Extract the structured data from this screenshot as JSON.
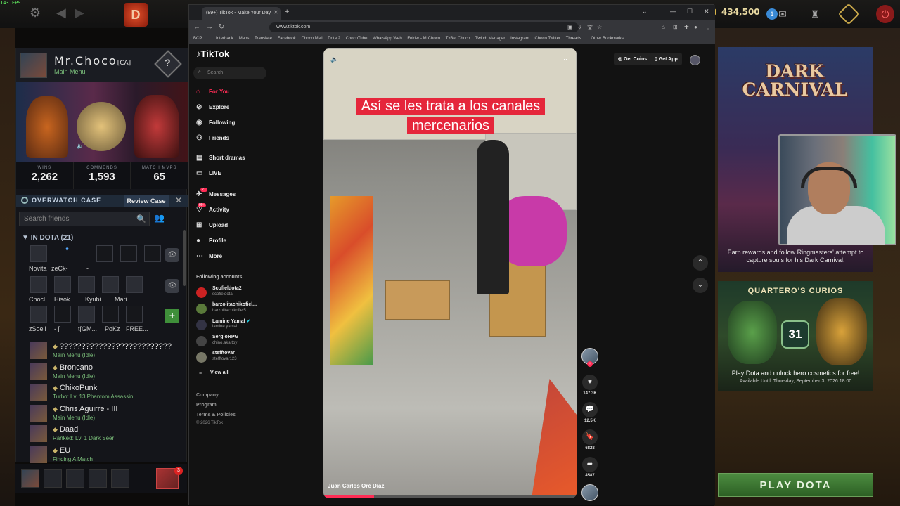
{
  "topbar": {
    "fps": "143 FPS",
    "gold": "434,500",
    "notif_count": "1"
  },
  "profile": {
    "name": "Mr.Choco",
    "tag": "[CA]",
    "status": "Main Menu",
    "stats": [
      {
        "label": "WINS",
        "value": "2,262"
      },
      {
        "label": "COMMENDS",
        "value": "1,593"
      },
      {
        "label": "MATCH MVPS",
        "value": "65"
      }
    ],
    "overwatch_label": "OVERWATCH CASE",
    "review_label": "Review Case",
    "search_placeholder": "Search friends",
    "in_dota_header": "IN DOTA (21)",
    "grid_names": [
      [
        "Novita",
        "zeCk-",
        "-"
      ],
      [
        "Chocl...",
        "Hisok...",
        "Kyubi...",
        "Mari..."
      ],
      [
        "zSoeli",
        "- [",
        "t[GM...",
        "PoKz",
        "FREE..."
      ]
    ],
    "friends": [
      {
        "name": "??????????????????????????",
        "status": "Main Menu (Idle)"
      },
      {
        "name": "Broncano",
        "status": "Main Menu (Idle)"
      },
      {
        "name": "ChikoPunk",
        "status": "Turbo: Lvl 13 Phantom Assassin"
      },
      {
        "name": "Chris Aguirre - III",
        "status": "Main Menu (Idle)"
      },
      {
        "name": "Daad",
        "status": "Ranked: Lvl 1 Dark Seer"
      },
      {
        "name": "EU",
        "status": "Finding A Match"
      }
    ],
    "party_badge": "3"
  },
  "browser": {
    "tab_title": "(89+) TikTok - Make Your Day",
    "url": "www.tiktok.com",
    "bookmarks": [
      "BCP",
      "Interbank",
      "Maps",
      "Translate",
      "Facebook",
      "Choco Mail",
      "Dota 2",
      "ChocoTube",
      "WhatsApp Web",
      "Folder - MrChoco",
      "TxBet Choco",
      "Twitch Manager",
      "Instagram",
      "Choco Twitter",
      "Threads",
      "Other Bookmarks"
    ]
  },
  "tiktok": {
    "logo": "TikTok",
    "search_placeholder": "Search",
    "nav": [
      {
        "label": "For You",
        "icon": "home-icon"
      },
      {
        "label": "Explore",
        "icon": "compass-icon"
      },
      {
        "label": "Following",
        "icon": "following-icon"
      },
      {
        "label": "Friends",
        "icon": "friends-icon"
      },
      {
        "label": "Short dramas",
        "icon": "drama-icon"
      },
      {
        "label": "LIVE",
        "icon": "live-icon"
      },
      {
        "label": "Messages",
        "icon": "messages-icon"
      },
      {
        "label": "Activity",
        "icon": "activity-icon"
      },
      {
        "label": "Upload",
        "icon": "upload-icon"
      },
      {
        "label": "Profile",
        "icon": "profile-icon"
      },
      {
        "label": "More",
        "icon": "more-icon"
      }
    ],
    "messages_badge": "21",
    "activity_badge": "99+",
    "following_header": "Following accounts",
    "following": [
      {
        "name": "Scofieldota2",
        "handle": "scofieldota"
      },
      {
        "name": "barzolitachikofiel...",
        "handle": "barzolitachikofiel5"
      },
      {
        "name": "Lamine Yamal",
        "handle": "lamine.yamal"
      },
      {
        "name": "SergioRPG",
        "handle": "chino.aka.toy"
      },
      {
        "name": "stefftovar",
        "handle": "stefftovar123"
      }
    ],
    "view_all": "View all",
    "footer": [
      "Company",
      "Program",
      "Terms & Policies"
    ],
    "copyright": "© 2026 TikTok",
    "get_coins": "Get Coins",
    "get_app": "Get App",
    "video": {
      "caption_line1": "Así se les trata a los canales",
      "caption_line2": "mercenarios",
      "author": "Juan Carlos Oré Díaz",
      "likes": "147.3K",
      "comments": "12.5K",
      "saves": "6828",
      "shares": "4587",
      "progress": 0.2
    }
  },
  "right": {
    "carnival_title_1": "DARK",
    "carnival_title_2": "CARNIVAL",
    "carnival_desc": "Earn rewards and follow Ringmasters' attempt to capture souls for his Dark Carnival.",
    "curios_title": "QUARTERO'S CURIOS",
    "curios_number": "31",
    "curios_desc": "Play Dota and unlock hero cosmetics for free!",
    "curios_avail": "Available Until: Thursday, September 3, 2026 18:00",
    "play_button": "PLAY DOTA"
  }
}
